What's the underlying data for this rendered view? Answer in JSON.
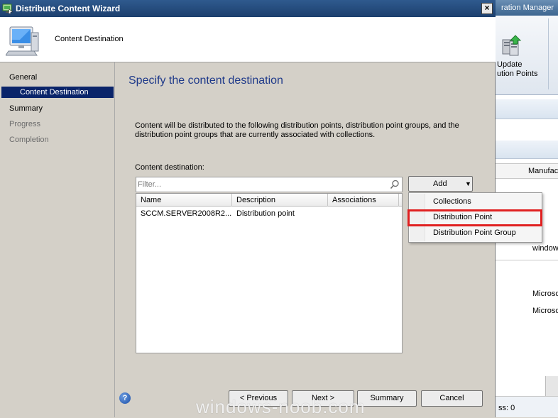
{
  "window": {
    "title": "Distribute Content Wizard",
    "close_glyph": "×",
    "header_title": "Content Destination"
  },
  "nav": {
    "items": [
      {
        "label": "General",
        "state": "normal"
      },
      {
        "label": "Content Destination",
        "state": "active"
      },
      {
        "label": "Summary",
        "state": "normal"
      },
      {
        "label": "Progress",
        "state": "disabled"
      },
      {
        "label": "Completion",
        "state": "disabled"
      }
    ]
  },
  "main": {
    "heading": "Specify the content destination",
    "description": "Content will be distributed to the following distribution points, distribution point groups, and the distribution point groups that are currently associated with collections.",
    "content_destination_label": "Content destination:",
    "filter_placeholder": "Filter...",
    "table": {
      "columns": [
        "Name",
        "Description",
        "Associations"
      ],
      "rows": [
        {
          "name": "SCCM.SERVER2008R2....",
          "description": "Distribution point",
          "associations": ""
        }
      ]
    },
    "add_button": {
      "label": "Add",
      "caret": "▼"
    },
    "add_menu": {
      "items": [
        "Collections",
        "Distribution Point",
        "Distribution Point Group"
      ],
      "highlighted": "Distribution Point"
    }
  },
  "footer": {
    "help_glyph": "?",
    "previous": "< Previous",
    "next": "Next >",
    "summary": "Summary",
    "cancel": "Cancel"
  },
  "background_console": {
    "title_fragment": "ration Manager",
    "ribbon_label_line1": "Update",
    "ribbon_label_line2": "ution Points",
    "column_header": "Manufac",
    "rows": [
      "window",
      "Microso",
      "Microso"
    ],
    "status_fragment": "ss: 0"
  },
  "watermark": "windows-noob.com",
  "colors": {
    "title_bar": "#1c3f6e",
    "nav_selected": "#0a246a",
    "heading": "#1f3a8a",
    "highlight_box": "#e02020"
  }
}
